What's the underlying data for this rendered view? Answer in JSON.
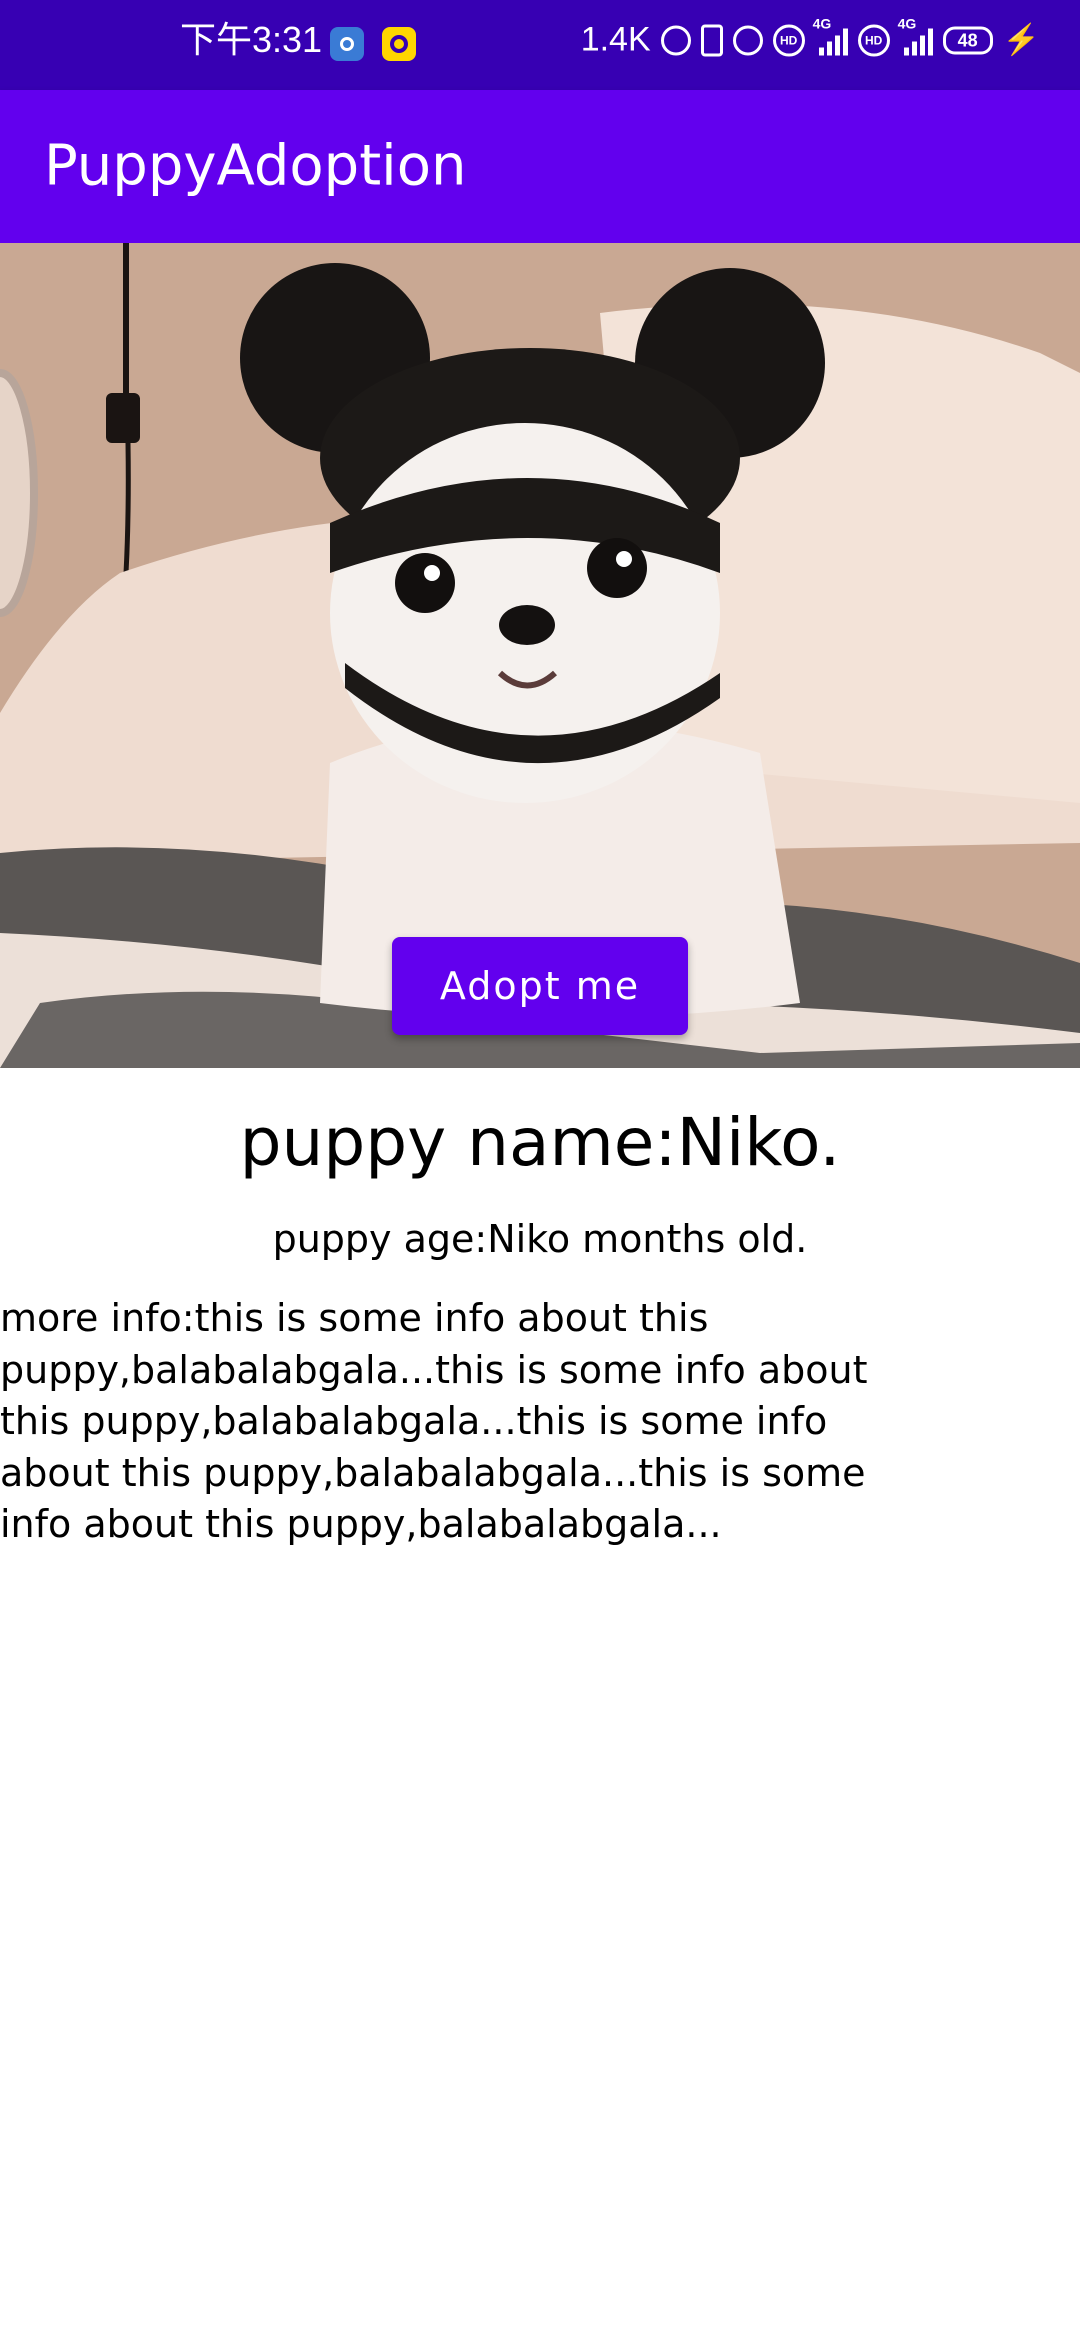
{
  "status_bar": {
    "time": "下午3:31",
    "network_speed": "1.4K",
    "network_type_1": "4G",
    "network_type_2": "4G",
    "hd_label": "HD",
    "battery_level": "48",
    "background_color": "#3700b3"
  },
  "app_bar": {
    "title": "PuppyAdoption",
    "color": "#6200ee"
  },
  "hero": {
    "image_icon": "puppy-photo",
    "adopt_label": "Adopt me"
  },
  "details": {
    "name_text": "puppy name:Niko.",
    "age_text": "puppy age:Niko months old.",
    "info_text": "more info:this is some info about this puppy,balabalabgala...this is some info about this puppy,balabalabgala...this is some info about this puppy,balabalabgala...this is some info about this puppy,balabalabgala..."
  }
}
